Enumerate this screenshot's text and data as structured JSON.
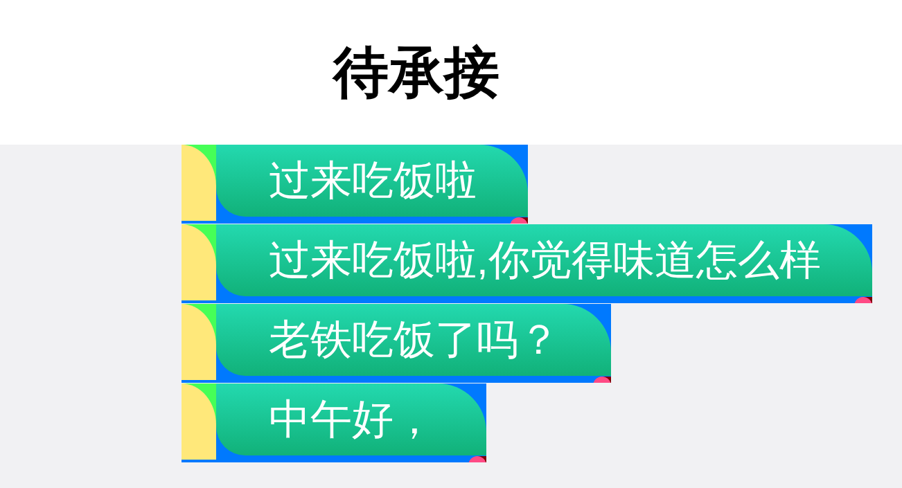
{
  "header": {
    "title": "待承接"
  },
  "messages": [
    {
      "text": "过来吃饭啦"
    },
    {
      "text": "过来吃饭啦,你觉得味道怎么样"
    },
    {
      "text": "老铁吃饭了吗？"
    },
    {
      "text": "中午好，"
    }
  ]
}
